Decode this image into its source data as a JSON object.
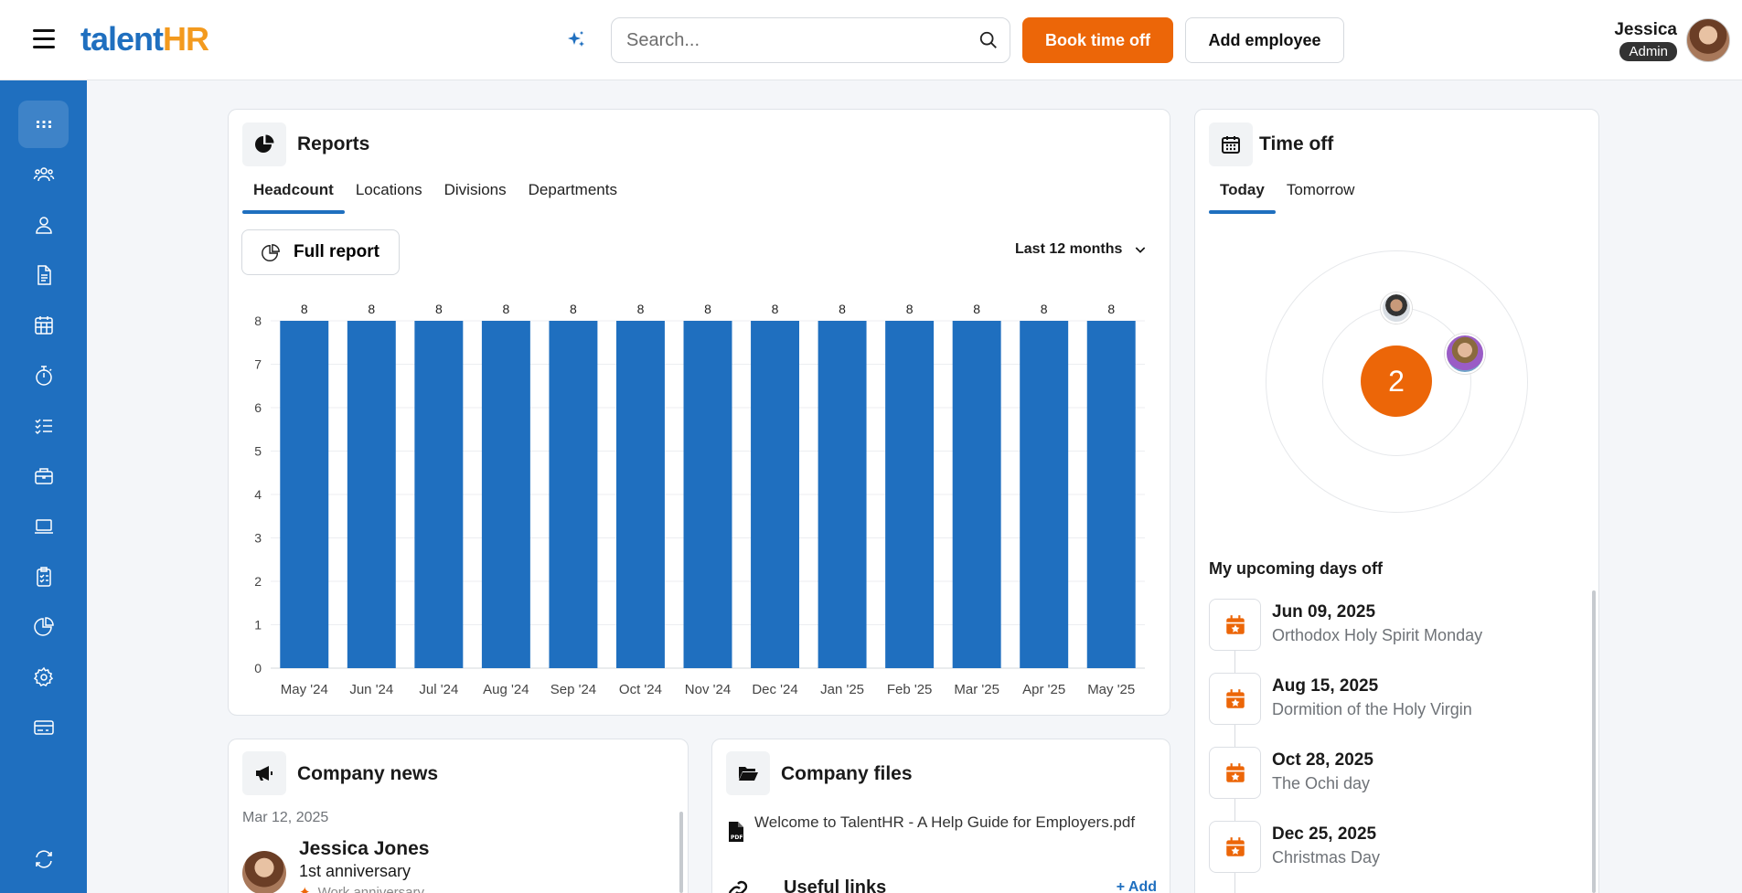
{
  "header": {
    "logo_main": "talent",
    "logo_accent": "HR",
    "search_placeholder": "Search...",
    "book_time_off": "Book time off",
    "add_employee": "Add employee",
    "user_name": "Jessica",
    "user_role": "Admin"
  },
  "sidebar": {
    "items": [
      {
        "icon": "dashboard-grid-icon",
        "active": true
      },
      {
        "icon": "people-icon"
      },
      {
        "icon": "person-icon"
      },
      {
        "icon": "document-icon"
      },
      {
        "icon": "calendar-icon"
      },
      {
        "icon": "stopwatch-icon"
      },
      {
        "icon": "checklist-icon"
      },
      {
        "icon": "briefcase-icon"
      },
      {
        "icon": "laptop-icon"
      },
      {
        "icon": "clipboard-icon"
      },
      {
        "icon": "pie-chart-icon"
      },
      {
        "icon": "gear-icon"
      },
      {
        "icon": "credit-card-icon"
      },
      {
        "icon": "switch-icon"
      }
    ]
  },
  "reports": {
    "title": "Reports",
    "tabs": [
      "Headcount",
      "Locations",
      "Divisions",
      "Departments"
    ],
    "active_tab": "Headcount",
    "full_report": "Full report",
    "range": "Last 12 months"
  },
  "chart_data": {
    "type": "bar",
    "categories": [
      "May '24",
      "Jun '24",
      "Jul '24",
      "Aug '24",
      "Sep '24",
      "Oct '24",
      "Nov '24",
      "Dec '24",
      "Jan '25",
      "Feb '25",
      "Mar '25",
      "Apr '25",
      "May '25"
    ],
    "values": [
      8,
      8,
      8,
      8,
      8,
      8,
      8,
      8,
      8,
      8,
      8,
      8,
      8
    ],
    "ylim": [
      0,
      8
    ],
    "yticks": [
      0,
      1,
      2,
      3,
      4,
      5,
      6,
      7,
      8
    ],
    "grid": true,
    "data_labels": true,
    "color": "#1f6fbf"
  },
  "time_off": {
    "title": "Time off",
    "tabs": [
      "Today",
      "Tomorrow"
    ],
    "active_tab": "Today",
    "count": "2",
    "upcoming_title": "My upcoming days off",
    "days": [
      {
        "date": "Jun 09, 2025",
        "name": "Orthodox Holy Spirit Monday"
      },
      {
        "date": "Aug 15, 2025",
        "name": "Dormition of the Holy Virgin"
      },
      {
        "date": "Oct 28, 2025",
        "name": "The Ochi day"
      },
      {
        "date": "Dec 25, 2025",
        "name": "Christmas Day"
      }
    ]
  },
  "company_news": {
    "title": "Company news",
    "date": "Mar 12, 2025",
    "person": "Jessica Jones",
    "event": "1st anniversary",
    "tag": "Work anniversary"
  },
  "company_files": {
    "title": "Company files",
    "file": "Welcome to TalentHR - A Help Guide for Employers.pdf",
    "useful_links": "Useful links",
    "add": "+ Add"
  },
  "colors": {
    "brand_blue": "#1f6fbf",
    "brand_orange": "#ec6608"
  }
}
